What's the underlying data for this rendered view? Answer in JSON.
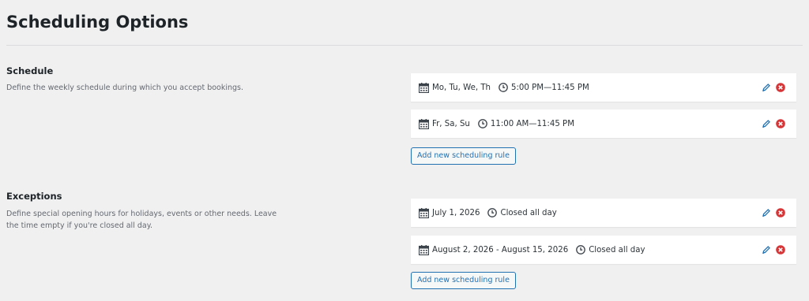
{
  "page": {
    "title": "Scheduling Options"
  },
  "schedule": {
    "title": "Schedule",
    "description": "Define the weekly schedule during which you accept bookings.",
    "rules": [
      {
        "date": "Mo, Tu, We, Th",
        "time": "5:00 PM—11:45 PM"
      },
      {
        "date": "Fr, Sa, Su",
        "time": "11:00 AM—11:45 PM"
      }
    ],
    "add_label": "Add new scheduling rule"
  },
  "exceptions": {
    "title": "Exceptions",
    "description": "Define special opening hours for holidays, events or other needs. Leave the time empty if you're closed all day.",
    "rules": [
      {
        "date": "July 1, 2026",
        "time": "Closed all day"
      },
      {
        "date": "August 2, 2026 - August 15, 2026",
        "time": "Closed all day"
      }
    ],
    "add_label": "Add new scheduling rule"
  },
  "icons": {
    "calendar": "calendar-icon",
    "clock": "clock-icon",
    "edit": "pencil-icon",
    "delete": "delete-circle-icon"
  },
  "colors": {
    "accent": "#2271b1",
    "danger": "#d63638",
    "background": "#f0f0f1"
  }
}
